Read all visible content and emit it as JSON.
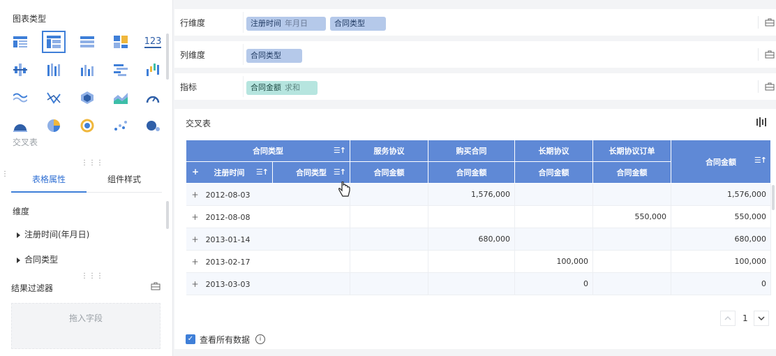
{
  "left_panel": {
    "chart_type_title": "图表类型",
    "selected_chart_label": "交叉表",
    "chart_icons": [
      "table-icon",
      "cross-table-icon",
      "grouped-table-icon",
      "kpi-blocks-icon",
      "number-card-icon",
      "box-plot-icon",
      "stacked-column-icon",
      "column-chart-icon",
      "bar-chart-icon",
      "waterfall-icon",
      "wave-line-icon",
      "radar-line-icon",
      "polygon-3d-icon",
      "area-chart-icon",
      "gauge-icon",
      "half-pie-icon",
      "pie-chart-icon",
      "donut-globe-icon",
      "scatter-icon",
      "bubble-icon"
    ],
    "number_card_text": "123",
    "tabs": [
      {
        "label": "表格属性",
        "active": true
      },
      {
        "label": "组件样式",
        "active": false
      }
    ],
    "dimension_title": "维度",
    "dimension_items": [
      "注册时间(年月日)",
      "合同类型"
    ],
    "filter_title": "结果过滤器",
    "filter_placeholder": "拖入字段"
  },
  "rows": {
    "row_dim": {
      "label": "行维度",
      "pills": [
        {
          "text": "注册时间",
          "sub": "年月日"
        },
        {
          "text": "合同类型",
          "sub": ""
        }
      ]
    },
    "col_dim": {
      "label": "列维度",
      "pills": [
        {
          "text": "合同类型",
          "sub": ""
        }
      ]
    },
    "metric": {
      "label": "指标",
      "pills": [
        {
          "text": "合同金额",
          "sub": "求和"
        }
      ]
    }
  },
  "card": {
    "title": "交叉表",
    "header_top": {
      "group_label": "合同类型",
      "cols": [
        "服务协议",
        "购买合同",
        "长期协议",
        "长期协议订单"
      ],
      "total": "合同金额"
    },
    "header_sub": {
      "plus": "+",
      "row_field_1": "注册时间",
      "row_field_2": "合同类型",
      "metric": "合同金额"
    },
    "rows": [
      {
        "date": "2012-08-03",
        "c1": "",
        "c2": "1,576,000",
        "c3": "",
        "c4": "",
        "total": "1,576,000"
      },
      {
        "date": "2012-08-08",
        "c1": "",
        "c2": "",
        "c3": "",
        "c4": "550,000",
        "total": "550,000"
      },
      {
        "date": "2013-01-14",
        "c1": "",
        "c2": "680,000",
        "c3": "",
        "c4": "",
        "total": "680,000"
      },
      {
        "date": "2013-02-17",
        "c1": "",
        "c2": "",
        "c3": "100,000",
        "c4": "",
        "total": "100,000"
      },
      {
        "date": "2013-03-03",
        "c1": "",
        "c2": "",
        "c3": "0",
        "c4": "",
        "total": "0"
      }
    ],
    "page_number": "1",
    "view_all_label": "查看所有数据",
    "view_all_checked": true
  },
  "colors": {
    "accent": "#3f7fd8",
    "header_bg": "#5f89d6",
    "pill_blue": "#b5c9ea",
    "pill_green": "#b6e5df"
  }
}
